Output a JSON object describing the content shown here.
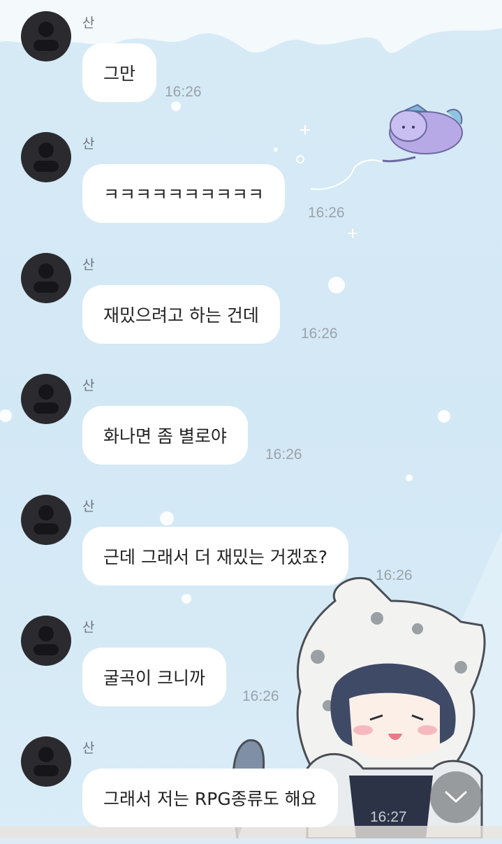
{
  "messages": [
    {
      "sender": "산",
      "text": "그만",
      "time": "16:26"
    },
    {
      "sender": "산",
      "text": "ㅋㅋㅋㅋㅋㅋㅋㅋㅋㅋ",
      "time": "16:26"
    },
    {
      "sender": "산",
      "text": "재밌으려고 하는 건데",
      "time": "16:26"
    },
    {
      "sender": "산",
      "text": "화나면 좀 별로야",
      "time": "16:26"
    },
    {
      "sender": "산",
      "text": "근데 그래서 더 재밌는 거겠죠?",
      "time": "16:26"
    },
    {
      "sender": "산",
      "text": "굴곡이 크니까",
      "time": "16:26"
    },
    {
      "sender": "산",
      "text": "그래서 저는 RPG종류도 해요",
      "time": "16:27"
    }
  ],
  "icons": {
    "avatar": "default-avatar-icon",
    "scroll_down": "chevron-down-icon"
  },
  "colors": {
    "background": "#d7eaf6",
    "bubble": "#ffffff",
    "avatar": "#2b2b2f",
    "timestamp": "#9aa3ab",
    "sender": "#6b7680"
  }
}
